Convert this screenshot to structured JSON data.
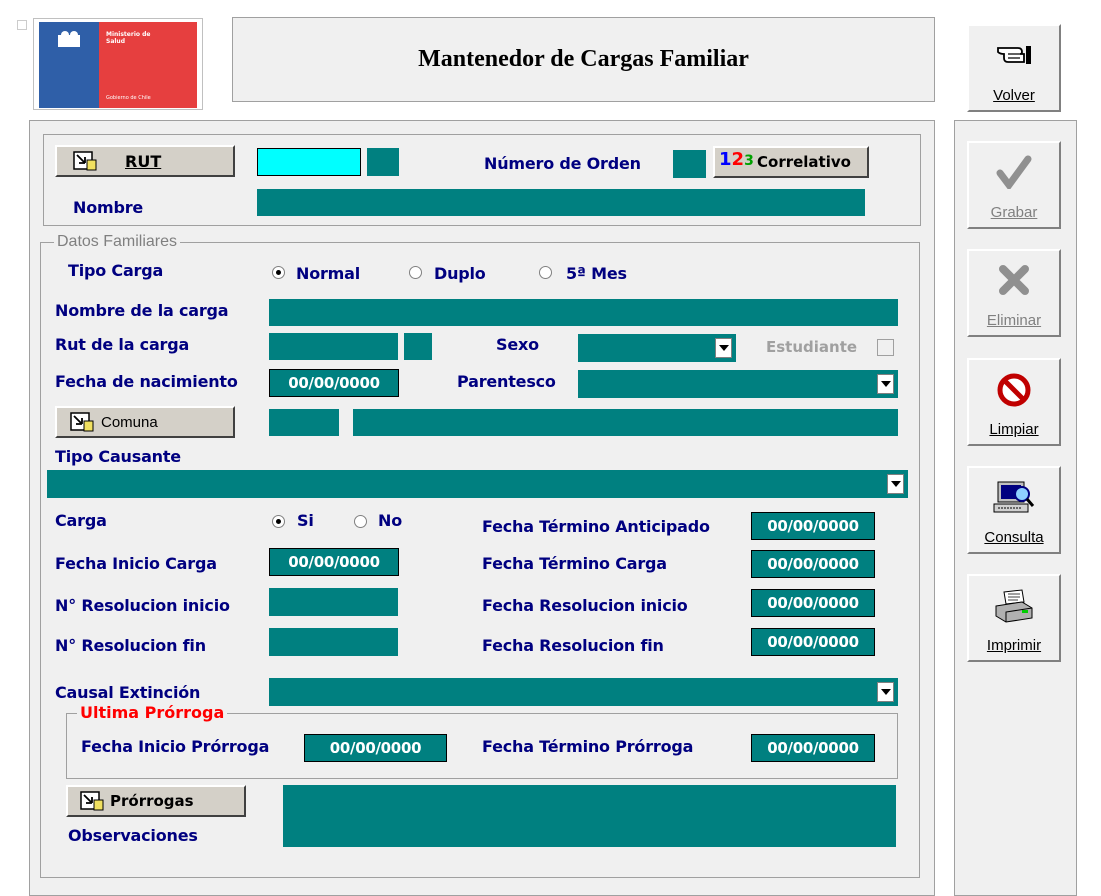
{
  "header": {
    "title": "Mantenedor de Cargas Familiar",
    "logo_line1": "Ministerio de",
    "logo_line2": "Salud",
    "logo_footer": "Gobierno de Chile"
  },
  "sidebar": {
    "volver": "Volver",
    "grabar": "Grabar",
    "eliminar": "Eliminar",
    "limpiar": "Limpiar",
    "consulta": "Consulta",
    "imprimir": "Imprimir"
  },
  "form": {
    "rut_button": "RUT",
    "numero_orden": "Número de Orden",
    "correlativo_button": "Correlativo",
    "nombre": "Nombre",
    "datos_familiares": "Datos Familiares",
    "tipo_carga": "Tipo Carga",
    "tipo_carga_options": [
      "Normal",
      "Duplo",
      "5ª Mes"
    ],
    "tipo_carga_selected": "Normal",
    "nombre_carga": "Nombre de la carga",
    "rut_carga": "Rut de la carga",
    "sexo": "Sexo",
    "estudiante": "Estudiante",
    "fecha_nacimiento": "Fecha de nacimiento",
    "fecha_nacimiento_value": "00/00/0000",
    "parentesco": "Parentesco",
    "comuna_button": "Comuna",
    "tipo_causante": "Tipo Causante",
    "carga": "Carga",
    "carga_options": [
      "Si",
      "No"
    ],
    "carga_selected": "Si",
    "fecha_termino_anticipado": "Fecha Término Anticipado",
    "fecha_termino_anticipado_value": "00/00/0000",
    "fecha_inicio_carga": "Fecha Inicio Carga",
    "fecha_inicio_carga_value": "00/00/0000",
    "fecha_termino_carga": "Fecha Término Carga",
    "fecha_termino_carga_value": "00/00/0000",
    "n_resolucion_inicio": "N° Resolucion inicio",
    "fecha_resolucion_inicio": "Fecha Resolucion inicio",
    "fecha_resolucion_inicio_value": "00/00/0000",
    "n_resolucion_fin": "N° Resolucion fin",
    "fecha_resolucion_fin": "Fecha Resolucion fin",
    "fecha_resolucion_fin_value": "00/00/0000",
    "causal_extincion": "Causal Extinción",
    "ultima_prorroga": "Ultima Prórroga",
    "fecha_inicio_prorroga": "Fecha Inicio Prórroga",
    "fecha_inicio_prorroga_value": "00/00/0000",
    "fecha_termino_prorroga": "Fecha Término Prórroga",
    "fecha_termino_prorroga_value": "00/00/0000",
    "prorrogas_button": "Prórrogas",
    "observaciones": "Observaciones"
  },
  "colors": {
    "field": "#008080",
    "highlight_field": "#00ffff",
    "label": "#000080",
    "group_title_red": "#ff0000"
  }
}
